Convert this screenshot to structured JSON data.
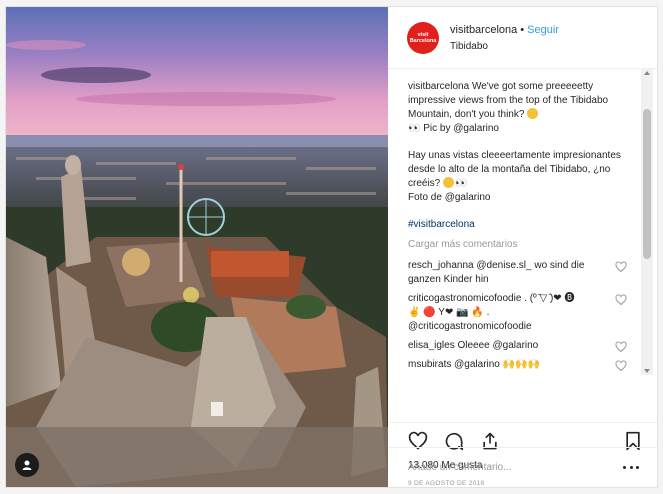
{
  "post": {
    "username": "visitbarcelona",
    "separator": "•",
    "follow_label": "Seguir",
    "location": "Tibidabo",
    "avatar_text_top": "visit",
    "avatar_text_bottom": "Barcelona"
  },
  "caption": {
    "username": "visitbarcelona",
    "english": "We've got some preeeeetty impressive views from the top of the Tibidabo Mountain, don't you think?",
    "credit_prefix": "Pic by",
    "credit_user": "@galarino",
    "spanish": "Hay unas vistas cleeeertamente impresionantes desde lo alto de la montaña del Tibidabo, ¿no creéis?",
    "foto_prefix": "Foto de",
    "foto_user": "@galarino",
    "hashtag": "#visitbarcelona"
  },
  "load_more": "Cargar más comentarios",
  "comments": [
    {
      "user": "resch_johanna",
      "text": "@denise.sl_ wo sind die ganzen Kinder hin"
    },
    {
      "user": "criticogastronomicofoodie",
      "text": ". (º ̄▽ ̄)❤ 🅑 ✌ 🔴 Y❤ 📷 🔥 . @criticogastronomicofoodie"
    },
    {
      "user": "elisa_igles",
      "text": "Oleeee @galarino"
    },
    {
      "user": "msubirats",
      "text": "@galarino"
    }
  ],
  "likes": "13.080 Me gusta",
  "date": "9 DE AGOSTO DE 2018",
  "add_comment_placeholder": "Añade un comentario...",
  "colors": {
    "brand_red": "#e1201b",
    "link_blue": "#3897f0",
    "text": "#262626",
    "muted": "#999999"
  },
  "icons": [
    "user-tag-icon",
    "heart-icon",
    "comment-icon",
    "share-icon",
    "bookmark-icon",
    "more-options-icon"
  ]
}
